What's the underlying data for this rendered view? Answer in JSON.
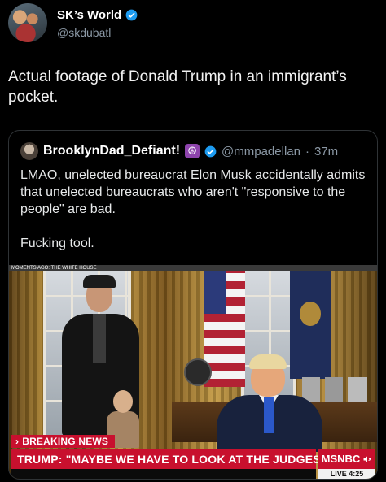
{
  "post": {
    "display_name": "SK’s World",
    "handle": "@skdubatl",
    "text": "Actual footage of Donald Trump in an immigrant’s pocket."
  },
  "quote": {
    "display_name": "BrooklynDad_Defiant!",
    "handle": "@mmpadellan",
    "separator": "·",
    "time": "37m",
    "paragraph1": "LMAO, unelected bureaucrat Elon Musk accidentally admits that unelected bureaucrats who aren't \"responsive to the people\" are bad.",
    "paragraph2": "Fucking tool."
  },
  "video": {
    "top_strip": "MOMENTS AGO: THE WHITE HOUSE",
    "breaking_label": "BREAKING NEWS",
    "breaking_arrow": "›",
    "headline": "TRUMP: \"MAYBE WE HAVE TO LOOK AT THE JUDGES\"",
    "network": "MSNBC",
    "live": "LIVE 4:25"
  },
  "colors": {
    "verified": "#1d9bf0",
    "chyron_red": "#c8102e",
    "peace_badge": "#8e44ad"
  },
  "icons": {
    "verified": "verified-badge-icon",
    "peace": "peace-sign-icon",
    "mute": "speaker-mute-icon"
  }
}
